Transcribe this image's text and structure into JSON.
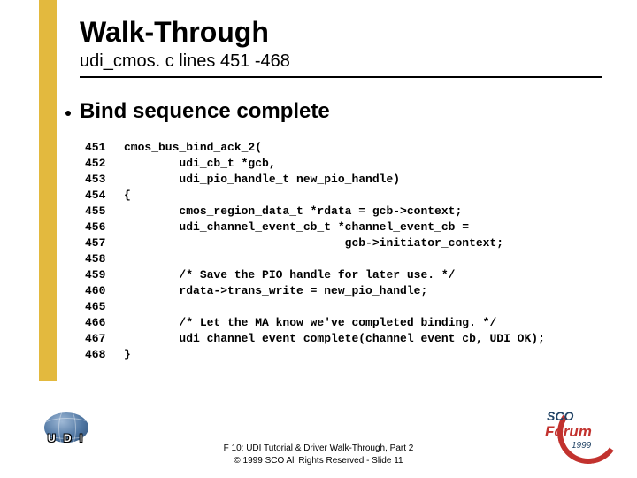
{
  "title": "Walk-Through",
  "subtitle": "udi_cmos. c lines 451 -468",
  "bullet": "Bind sequence complete",
  "code": [
    {
      "n": "451",
      "t": "cmos_bus_bind_ack_2("
    },
    {
      "n": "452",
      "t": "        udi_cb_t *gcb,"
    },
    {
      "n": "453",
      "t": "        udi_pio_handle_t new_pio_handle)"
    },
    {
      "n": "454",
      "t": "{"
    },
    {
      "n": "455",
      "t": "        cmos_region_data_t *rdata = gcb->context;"
    },
    {
      "n": "456",
      "t": "        udi_channel_event_cb_t *channel_event_cb ="
    },
    {
      "n": "457",
      "t": "                                gcb->initiator_context;"
    },
    {
      "n": "458",
      "t": ""
    },
    {
      "n": "459",
      "t": "        /* Save the PIO handle for later use. */"
    },
    {
      "n": "460",
      "t": "        rdata->trans_write = new_pio_handle;"
    },
    {
      "n": "465",
      "t": ""
    },
    {
      "n": "466",
      "t": "        /* Let the MA know we've completed binding. */"
    },
    {
      "n": "467",
      "t": "        udi_channel_event_complete(channel_event_cb, UDI_OK);"
    },
    {
      "n": "468",
      "t": "}"
    }
  ],
  "footer": {
    "line1": "F 10: UDI Tutorial & Driver Walk-Through, Part 2",
    "line2": "© 1999 SCO  All Rights Reserved - Slide 11"
  },
  "logos": {
    "udi_text": "U D I",
    "sco": "SCO",
    "forum": "Forum",
    "year": "1999"
  }
}
